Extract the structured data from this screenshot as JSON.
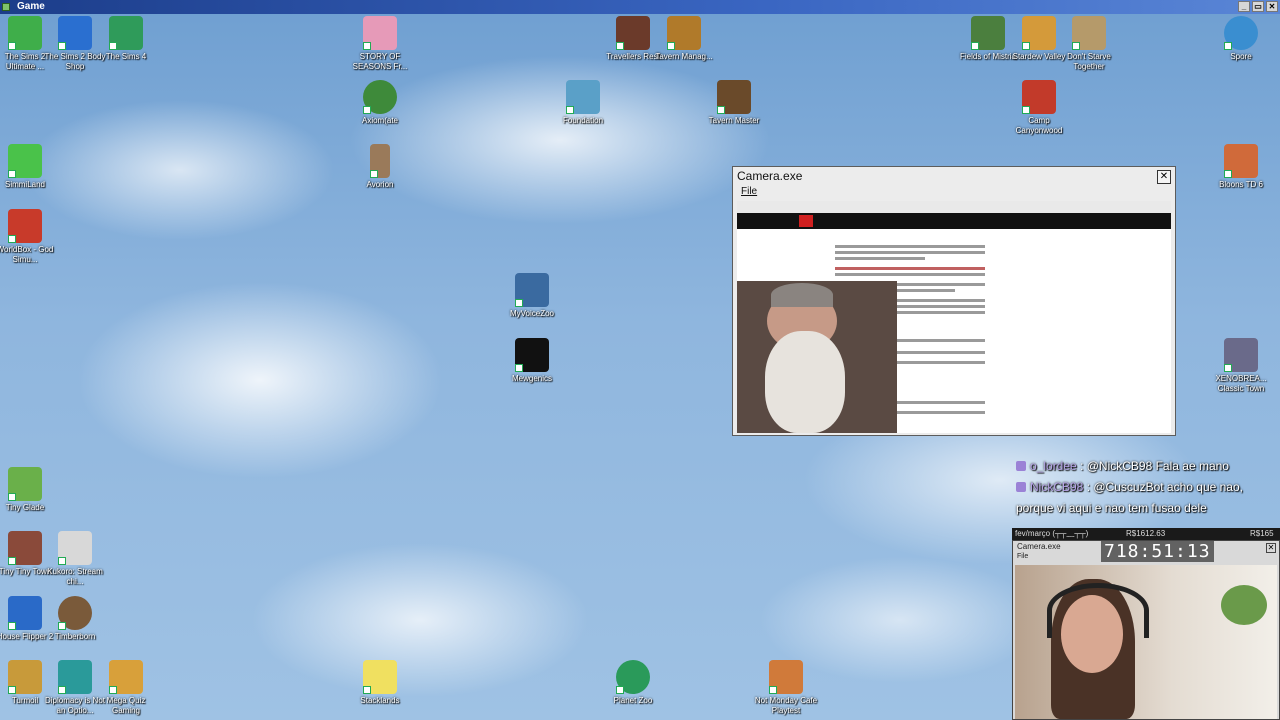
{
  "window": {
    "title": "Game",
    "buttons": [
      "_",
      "▭",
      "✕"
    ]
  },
  "desktop_icons": [
    {
      "id": "sims2",
      "label": "The Sims 2 Ultimate ...",
      "color": "#3fae4a"
    },
    {
      "id": "sims2body",
      "label": "The Sims 2 Body Shop",
      "color": "#2a6fd0"
    },
    {
      "id": "sims4",
      "label": "The Sims 4",
      "color": "#2f9b5a"
    },
    {
      "id": "storyseasons",
      "label": "STORY OF SEASONS Fr...",
      "color": "#e69ab8"
    },
    {
      "id": "travellersrest",
      "label": "Travellers Rest",
      "color": "#6b3a2a"
    },
    {
      "id": "tavernmanag",
      "label": "Tavern Manag...",
      "color": "#b07a2a"
    },
    {
      "id": "fieldsmistria",
      "label": "Fields of Mistria",
      "color": "#4b7f3e"
    },
    {
      "id": "stardew",
      "label": "Stardew Valley",
      "color": "#d49a3a"
    },
    {
      "id": "dontstarve",
      "label": "Don't Starve Together",
      "color": "#b59a6a"
    },
    {
      "id": "spore",
      "label": "Spore",
      "color": "#3a8ed0"
    },
    {
      "id": "axiomverge",
      "label": "Axiom(ate",
      "color": "#3e8a3a"
    },
    {
      "id": "foundation",
      "label": "Foundation",
      "color": "#5aa0c8"
    },
    {
      "id": "tavernmaster",
      "label": "Tavern Master",
      "color": "#6a4a2a"
    },
    {
      "id": "campcanyonwood",
      "label": "Camp Canyonwood",
      "color": "#c23a2a"
    },
    {
      "id": "simmiland",
      "label": "SimmiLand",
      "color": "#4ac24a"
    },
    {
      "id": "avorion",
      "label": "Avorion",
      "color": "#9a7a5a"
    },
    {
      "id": "bloonstd6",
      "label": "Bloons TD 6",
      "color": "#d06a3a"
    },
    {
      "id": "worldbox",
      "label": "WorldBox - God Simu...",
      "color": "#c83a2a"
    },
    {
      "id": "myvoicezoo",
      "label": "MyVoiceZoo",
      "color": "#3a6aa0"
    },
    {
      "id": "mewgenics",
      "label": "Mewgenics",
      "color": "#111111"
    },
    {
      "id": "xenobreak",
      "label": "XENOBREA... Classic Town",
      "color": "#6a6a8a"
    },
    {
      "id": "tinyglade",
      "label": "Tiny Glade",
      "color": "#6ab04a"
    },
    {
      "id": "tinytinytown",
      "label": "Tiny Tiny Town",
      "color": "#8a4a3a"
    },
    {
      "id": "kukoro",
      "label": "Kukoro: Stream chi...",
      "color": "#d8d8d8"
    },
    {
      "id": "houseflipper2",
      "label": "House Flipper 2",
      "color": "#2a6ac8"
    },
    {
      "id": "timberborn",
      "label": "Timberborn",
      "color": "#7a5a3a"
    },
    {
      "id": "turmoil",
      "label": "Turmoil",
      "color": "#c89a3a"
    },
    {
      "id": "diplomacy",
      "label": "Diplomacy is Not an Optio...",
      "color": "#2a9a9a"
    },
    {
      "id": "megaquiz",
      "label": "Mega Quiz Gaming",
      "color": "#d8a03a"
    },
    {
      "id": "stacklands",
      "label": "Stacklands",
      "color": "#f0e060"
    },
    {
      "id": "planetzoo",
      "label": "Planet Zoo",
      "color": "#2a9a5a"
    },
    {
      "id": "notmonday",
      "label": "Not Monday Cafe Playtest",
      "color": "#d07a3a"
    }
  ],
  "camera_window": {
    "title": "Camera.exe",
    "menu_file": "File",
    "close": "✕"
  },
  "chat": [
    {
      "user": "o_lordee",
      "message": ": @NickCB98 Fala ae mano"
    },
    {
      "user": "NickCB98",
      "message": ": @CuscuzBot acho que nao, porque vi aqui e nao tem fusao dele"
    }
  ],
  "overlay": {
    "period": "fev/março (┬┬﹏┬┬)",
    "amount1": "R$1612.63",
    "amount2": "R$165",
    "cam_title": "Camera.exe",
    "cam_file": "File",
    "timer": "718:51:13"
  }
}
